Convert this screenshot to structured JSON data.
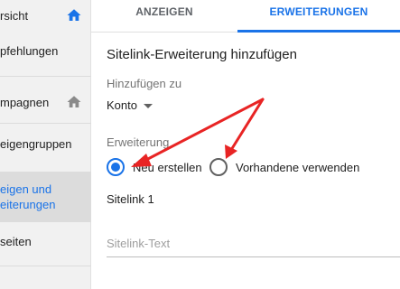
{
  "sidebar": {
    "items": [
      {
        "label": "rsicht",
        "icon": "home-icon"
      },
      {
        "label": "pfehlungen"
      },
      {
        "label": "mpagnen",
        "icon": "home-icon"
      },
      {
        "label": "eigengruppen"
      },
      {
        "label_line1": "eigen und",
        "label_line2": "eiterungen",
        "active": true
      },
      {
        "label": "seiten"
      }
    ]
  },
  "tabs": [
    {
      "label": "ANZEIGEN",
      "active": false
    },
    {
      "label": "ERWEITERUNGEN",
      "active": true
    }
  ],
  "form": {
    "title": "Sitelink-Erweiterung hinzufügen",
    "add_to_label": "Hinzufügen zu",
    "add_to_value": "Konto",
    "extension_label": "Erweiterung",
    "radio_new": "Neu erstellen",
    "radio_existing": "Vorhandene verwenden",
    "radio_selected": "new",
    "sitelink_heading": "Sitelink 1",
    "sitelink_text_placeholder": "Sitelink-Text"
  },
  "colors": {
    "accent": "#1a73e8",
    "annotation_arrow": "#e82424",
    "sidebar_bg": "#f1f1f1"
  }
}
